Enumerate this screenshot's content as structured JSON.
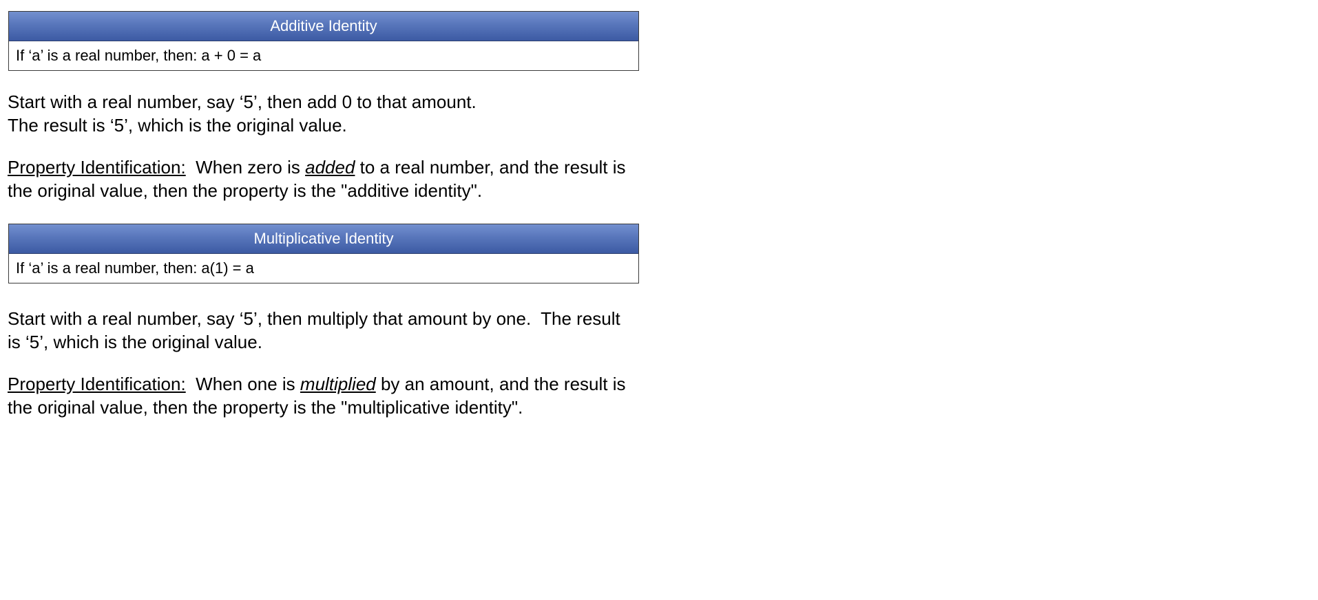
{
  "sections": [
    {
      "box": {
        "title": "Additive Identity",
        "rule": "If ‘a’ is a real number, then:  a + 0 = a"
      },
      "example": {
        "line1": "Start with a real number, say ‘5’, then add 0 to that amount.",
        "line2": "The result is ‘5’, which is the original value."
      },
      "identification": {
        "label": "Property Identification:",
        "before": "  When zero is ",
        "emphasis": "added",
        "after_line1": " to a real number, and the result is",
        "line2": "the original value, then the property is the \"additive identity\"."
      }
    },
    {
      "box": {
        "title": "Multiplicative Identity",
        "rule": "If ‘a’ is a real number, then:  a(1) = a"
      },
      "example": {
        "line1": "Start with a real number, say ‘5’, then multiply that amount by one.  The result",
        "line2": "is ‘5’, which is the original value."
      },
      "identification": {
        "label": "Property Identification:",
        "before": "  When one is ",
        "emphasis": "multiplied",
        "after_line1": " by an amount, and the result is",
        "line2": "the original value, then the property is the \"multiplicative identity\"."
      }
    }
  ],
  "colors": {
    "header_top": "#7390cf",
    "header_bottom": "#3c5aa3",
    "header_text": "#ffffff",
    "body_text": "#000000"
  }
}
